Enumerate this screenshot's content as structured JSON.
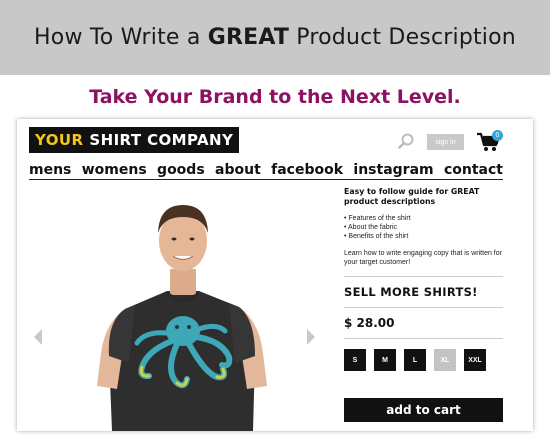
{
  "banner": {
    "title_prefix": "How To Write a ",
    "title_emphasis": "GREAT",
    "title_suffix": " Product Description",
    "subtitle": "Take Your Brand to the Next Level."
  },
  "site": {
    "logo_part1": "YOUR",
    "logo_part2": "SHIRT COMPANY",
    "signin_label": "sign in",
    "cart_count": "0",
    "accent_color": "#2fa8d9",
    "logo_color": "#f5c518"
  },
  "nav": {
    "items": [
      "mens",
      "womens",
      "goods",
      "about",
      "facebook",
      "instagram",
      "contact"
    ]
  },
  "product": {
    "description_title": "Easy to follow guide for GREAT product descriptions",
    "bullets": [
      "• Features of the shirt",
      "• About the fabric",
      "• Benefits of the shirt"
    ],
    "learn_text": "Learn how to write engaging copy that is written for your target customer!",
    "headline": "SELL MORE SHIRTS!",
    "price": "$ 28.00",
    "sizes": [
      {
        "label": "S",
        "available": true
      },
      {
        "label": "M",
        "available": true
      },
      {
        "label": "L",
        "available": true
      },
      {
        "label": "XL",
        "available": false
      },
      {
        "label": "XXL",
        "available": true
      }
    ],
    "add_to_cart_label": "add to cart"
  },
  "icons": {
    "search": "search-icon",
    "cart": "shopping-cart-icon",
    "prev": "chevron-left-icon",
    "next": "chevron-right-icon"
  }
}
